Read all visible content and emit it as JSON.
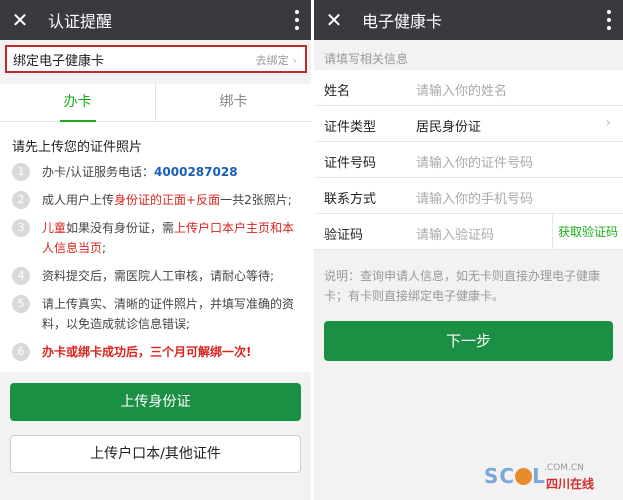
{
  "left": {
    "topbar": {
      "title": "认证提醒"
    },
    "bind_bar": {
      "label": "绑定电子健康卡",
      "action": "去绑定"
    },
    "tabs": [
      "办卡",
      "绑卡"
    ],
    "heading": "请先上传您的证件照片",
    "steps": [
      {
        "num": "1",
        "pre": "办卡/认证服务电话：",
        "phone": "4000287028"
      },
      {
        "num": "2",
        "pre": "成人用户上传",
        "red": "身份证的正面+反面",
        "post": "一共2张照片;"
      },
      {
        "num": "3",
        "red1": "儿童",
        "mid": "如果没有身份证，需",
        "red2": "上传户口本户主页和本人信息当页",
        "post": ";"
      },
      {
        "num": "4",
        "text": "资料提交后，需医院人工审核，请耐心等待;"
      },
      {
        "num": "5",
        "text": "请上传真实、清晰的证件照片，并填写准确的资料，以免造成就诊信息错误;"
      },
      {
        "num": "6",
        "red": "办卡或绑卡成功后，三个月可解绑一次!"
      }
    ],
    "btn_upload_id": "上传身份证",
    "btn_upload_other": "上传户口本/其他证件"
  },
  "right": {
    "topbar": {
      "title": "电子健康卡"
    },
    "hint": "请填写相关信息",
    "fields": [
      {
        "label": "姓名",
        "placeholder": "请输入你的姓名"
      },
      {
        "label": "证件类型",
        "value": "居民身份证"
      },
      {
        "label": "证件号码",
        "placeholder": "请输入你的证件号码"
      },
      {
        "label": "联系方式",
        "placeholder": "请输入你的手机号码"
      },
      {
        "label": "验证码",
        "placeholder": "请输入验证码",
        "button": "获取验证码"
      }
    ],
    "note": "说明：查询申请人信息，如无卡则直接办理电子健康卡；有卡则直接绑定电子健康卡。",
    "btn_next": "下一步"
  },
  "watermark": {
    "logo_pre": "SC",
    "logo_post": "L",
    "domain": ".COM.CN",
    "cn": "四川在线"
  },
  "colors": {
    "topbar": "#393a3f",
    "primary_green": "#1b8f44",
    "accent_green": "#1aad19",
    "alert_red": "#d9251d",
    "highlight_border": "#c0282a"
  }
}
